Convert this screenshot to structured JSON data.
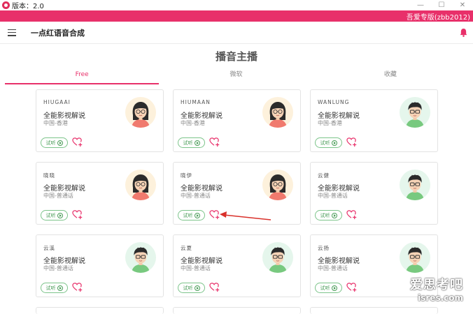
{
  "window": {
    "title": "版本：2.0"
  },
  "banner": {
    "text": "吾爱专版(zbb2012)"
  },
  "header": {
    "app_title": "一点红语音合成"
  },
  "page": {
    "title": "播音主播"
  },
  "tabs": [
    {
      "label": "Free",
      "active": true
    },
    {
      "label": "微软",
      "active": false
    },
    {
      "label": "收藏",
      "active": false
    }
  ],
  "listen_label": "试听",
  "cards": [
    {
      "name": "HIUGAAI",
      "type": "全能影视解说",
      "lang": "中国-香港",
      "avatar": "female"
    },
    {
      "name": "HIUMAAN",
      "type": "全能影视解说",
      "lang": "中国-香港",
      "avatar": "female"
    },
    {
      "name": "WANLUNG",
      "type": "全能影视解说",
      "lang": "中国-香港",
      "avatar": "male"
    },
    {
      "name": "晓晓",
      "type": "全能影视解说",
      "lang": "中国-普通话",
      "avatar": "female"
    },
    {
      "name": "晓伊",
      "type": "全能影视解说",
      "lang": "中国-普通话",
      "avatar": "female"
    },
    {
      "name": "云健",
      "type": "全能影视解说",
      "lang": "中国-普通话",
      "avatar": "male"
    },
    {
      "name": "云溪",
      "type": "全能影视解说",
      "lang": "中国-普通话",
      "avatar": "male"
    },
    {
      "name": "云夏",
      "type": "全能影视解说",
      "lang": "中国-普通话",
      "avatar": "male"
    },
    {
      "name": "云扬",
      "type": "全能影视解说",
      "lang": "中国-普通话",
      "avatar": "male"
    }
  ],
  "watermark": {
    "line1": "爱思考吧",
    "line2": "isres.com"
  },
  "colors": {
    "accent": "#e8306a",
    "listen": "#4a9d59"
  }
}
